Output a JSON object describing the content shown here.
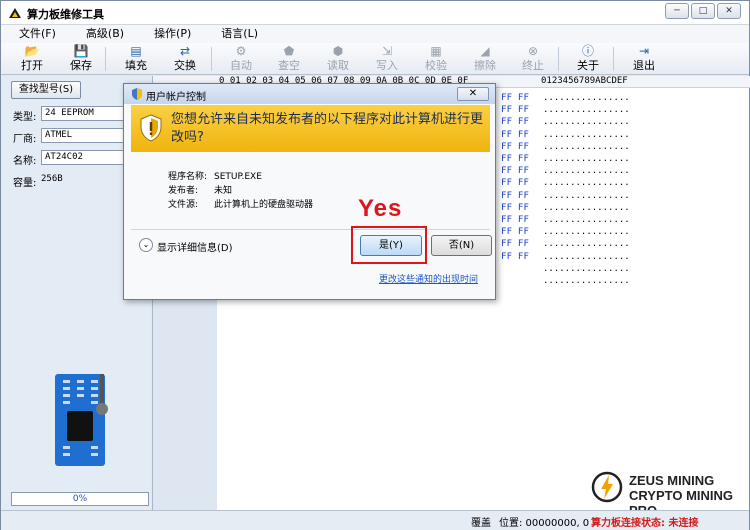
{
  "window": {
    "title": "算力板维修工具",
    "minimize": "─",
    "maximize": "□",
    "close": "✕"
  },
  "menu": [
    "文件(F)",
    "高级(B)",
    "操作(P)",
    "语言(L)"
  ],
  "toolbar": [
    {
      "label": "打开",
      "icon": "open-folder-icon",
      "glyph": "📂",
      "enabled": true
    },
    {
      "label": "保存",
      "icon": "save-icon",
      "glyph": "💾",
      "enabled": true
    },
    {
      "label": "填充",
      "icon": "fill-icon",
      "glyph": "▤",
      "enabled": true
    },
    {
      "label": "交换",
      "icon": "swap-icon",
      "glyph": "⇄",
      "enabled": true
    },
    {
      "label": "自动",
      "icon": "auto-icon",
      "glyph": "⚙",
      "enabled": false
    },
    {
      "label": "查空",
      "icon": "blank-check-icon",
      "glyph": "⬟",
      "enabled": false
    },
    {
      "label": "读取",
      "icon": "read-icon",
      "glyph": "⬢",
      "enabled": false
    },
    {
      "label": "写入",
      "icon": "write-icon",
      "glyph": "⇲",
      "enabled": false
    },
    {
      "label": "校验",
      "icon": "verify-icon",
      "glyph": "▦",
      "enabled": false
    },
    {
      "label": "擦除",
      "icon": "erase-icon",
      "glyph": "◢",
      "enabled": false
    },
    {
      "label": "终止",
      "icon": "stop-icon",
      "glyph": "⊗",
      "enabled": false
    },
    {
      "label": "关于",
      "icon": "info-icon",
      "glyph": "ⓘ",
      "enabled": true
    },
    {
      "label": "退出",
      "icon": "exit-icon",
      "glyph": "⇥",
      "enabled": true
    }
  ],
  "left": {
    "find_button": "查找型号(S)",
    "type_label": "类型:",
    "type_value": "24 EEPROM",
    "vendor_label": "厂商:",
    "vendor_value": "ATMEL",
    "name_label": "名称:",
    "name_value": "AT24C02",
    "capacity_label": "容量:",
    "capacity_value": "256B",
    "progress": "0%"
  },
  "hex": {
    "header_offsets": "0 01 02 03 04 05 06 07 08 09 0A 0B 0C 0D 0E 0F",
    "header_ascii": "0123456789ABCDEF",
    "rows": [
      {
        "addr": "",
        "hex": "FF FF",
        "ascii": "................"
      },
      {
        "addr": "",
        "hex": "FF FF",
        "ascii": "................"
      },
      {
        "addr": "",
        "hex": "FF FF",
        "ascii": "................"
      },
      {
        "addr": "",
        "hex": "FF FF",
        "ascii": "................"
      },
      {
        "addr": "",
        "hex": "FF FF",
        "ascii": "................"
      },
      {
        "addr": "",
        "hex": "FF FF",
        "ascii": "................"
      },
      {
        "addr": "",
        "hex": "FF FF",
        "ascii": "................"
      },
      {
        "addr": "",
        "hex": "FF FF",
        "ascii": "................"
      },
      {
        "addr": "",
        "hex": "FF FF",
        "ascii": "................"
      },
      {
        "addr": "",
        "hex": "FF FF",
        "ascii": "................"
      },
      {
        "addr": "",
        "hex": "FF FF",
        "ascii": "................"
      },
      {
        "addr": "",
        "hex": "FF FF",
        "ascii": "................"
      },
      {
        "addr": "",
        "hex": "FF FF",
        "ascii": "................"
      },
      {
        "addr": "",
        "hex": "FF FF",
        "ascii": "................"
      },
      {
        "addr": "000000E0",
        "hex": "FF FF FF FF FF FF FF FF FF FF FF FF FF FF FF FF",
        "ascii": "................"
      },
      {
        "addr": "000000F0",
        "hex": "FF FF FF FF FF FF FF FF FF FF FF FF FF FF FF FF",
        "ascii": "................"
      }
    ]
  },
  "status": {
    "mode": "覆盖",
    "position": "位置: 00000000, 0",
    "connection": "算力板连接状态: 未连接"
  },
  "logo": {
    "line1": "ZEUS MINING",
    "line2": "CRYPTO MINING PRO"
  },
  "uac": {
    "title": "用户帐户控制",
    "question": "您想允许来自未知发布者的以下程序对此计算机进行更改吗?",
    "program_label": "程序名称:",
    "program_value": "SETUP.EXE",
    "publisher_label": "发布者:",
    "publisher_value": "未知",
    "source_label": "文件源:",
    "source_value": "此计算机上的硬盘驱动器",
    "details": "显示详细信息(D)",
    "yes": "是(Y)",
    "no": "否(N)",
    "link": "更改这些通知的出现时间"
  },
  "annotation": {
    "text": "Yes",
    "color": "#e0141b"
  }
}
